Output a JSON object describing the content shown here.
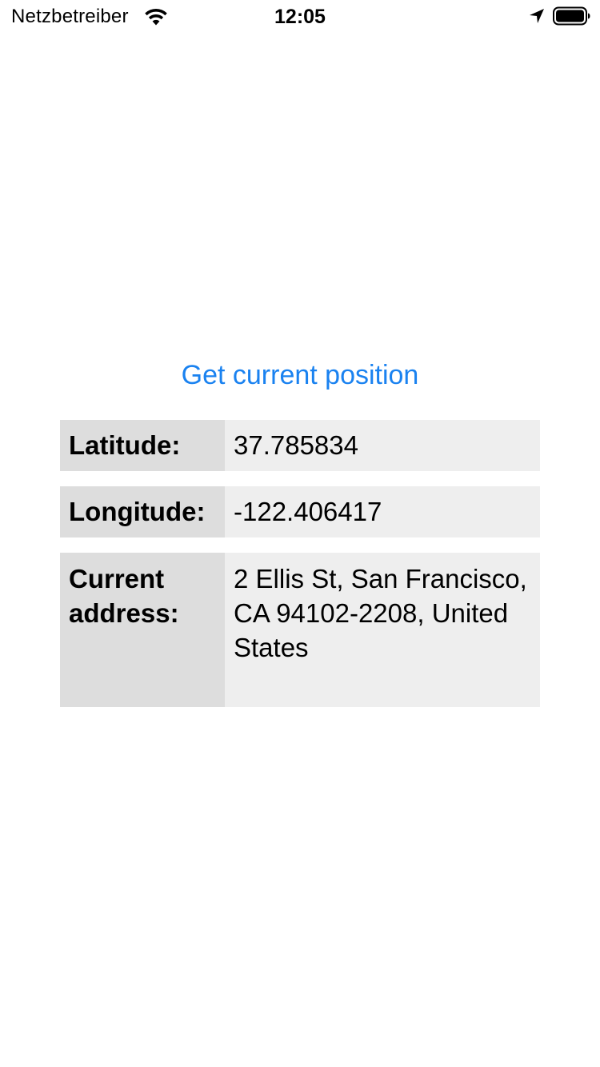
{
  "status_bar": {
    "carrier": "Netzbetreiber",
    "time": "12:05",
    "icons": [
      "wifi-icon",
      "location-arrow-icon",
      "battery-icon"
    ]
  },
  "main": {
    "get_position_label": "Get current position",
    "rows": [
      {
        "label": "Latitude:",
        "value": "37.785834"
      },
      {
        "label": "Longitude:",
        "value": "-122.406417"
      },
      {
        "label": "Current address:",
        "value": "2 Ellis St, San Francisco, CA 94102-2208, United States"
      }
    ]
  },
  "colors": {
    "accent": "#1a82f0",
    "label_bg": "#dddddd",
    "value_bg": "#eeeeee"
  }
}
